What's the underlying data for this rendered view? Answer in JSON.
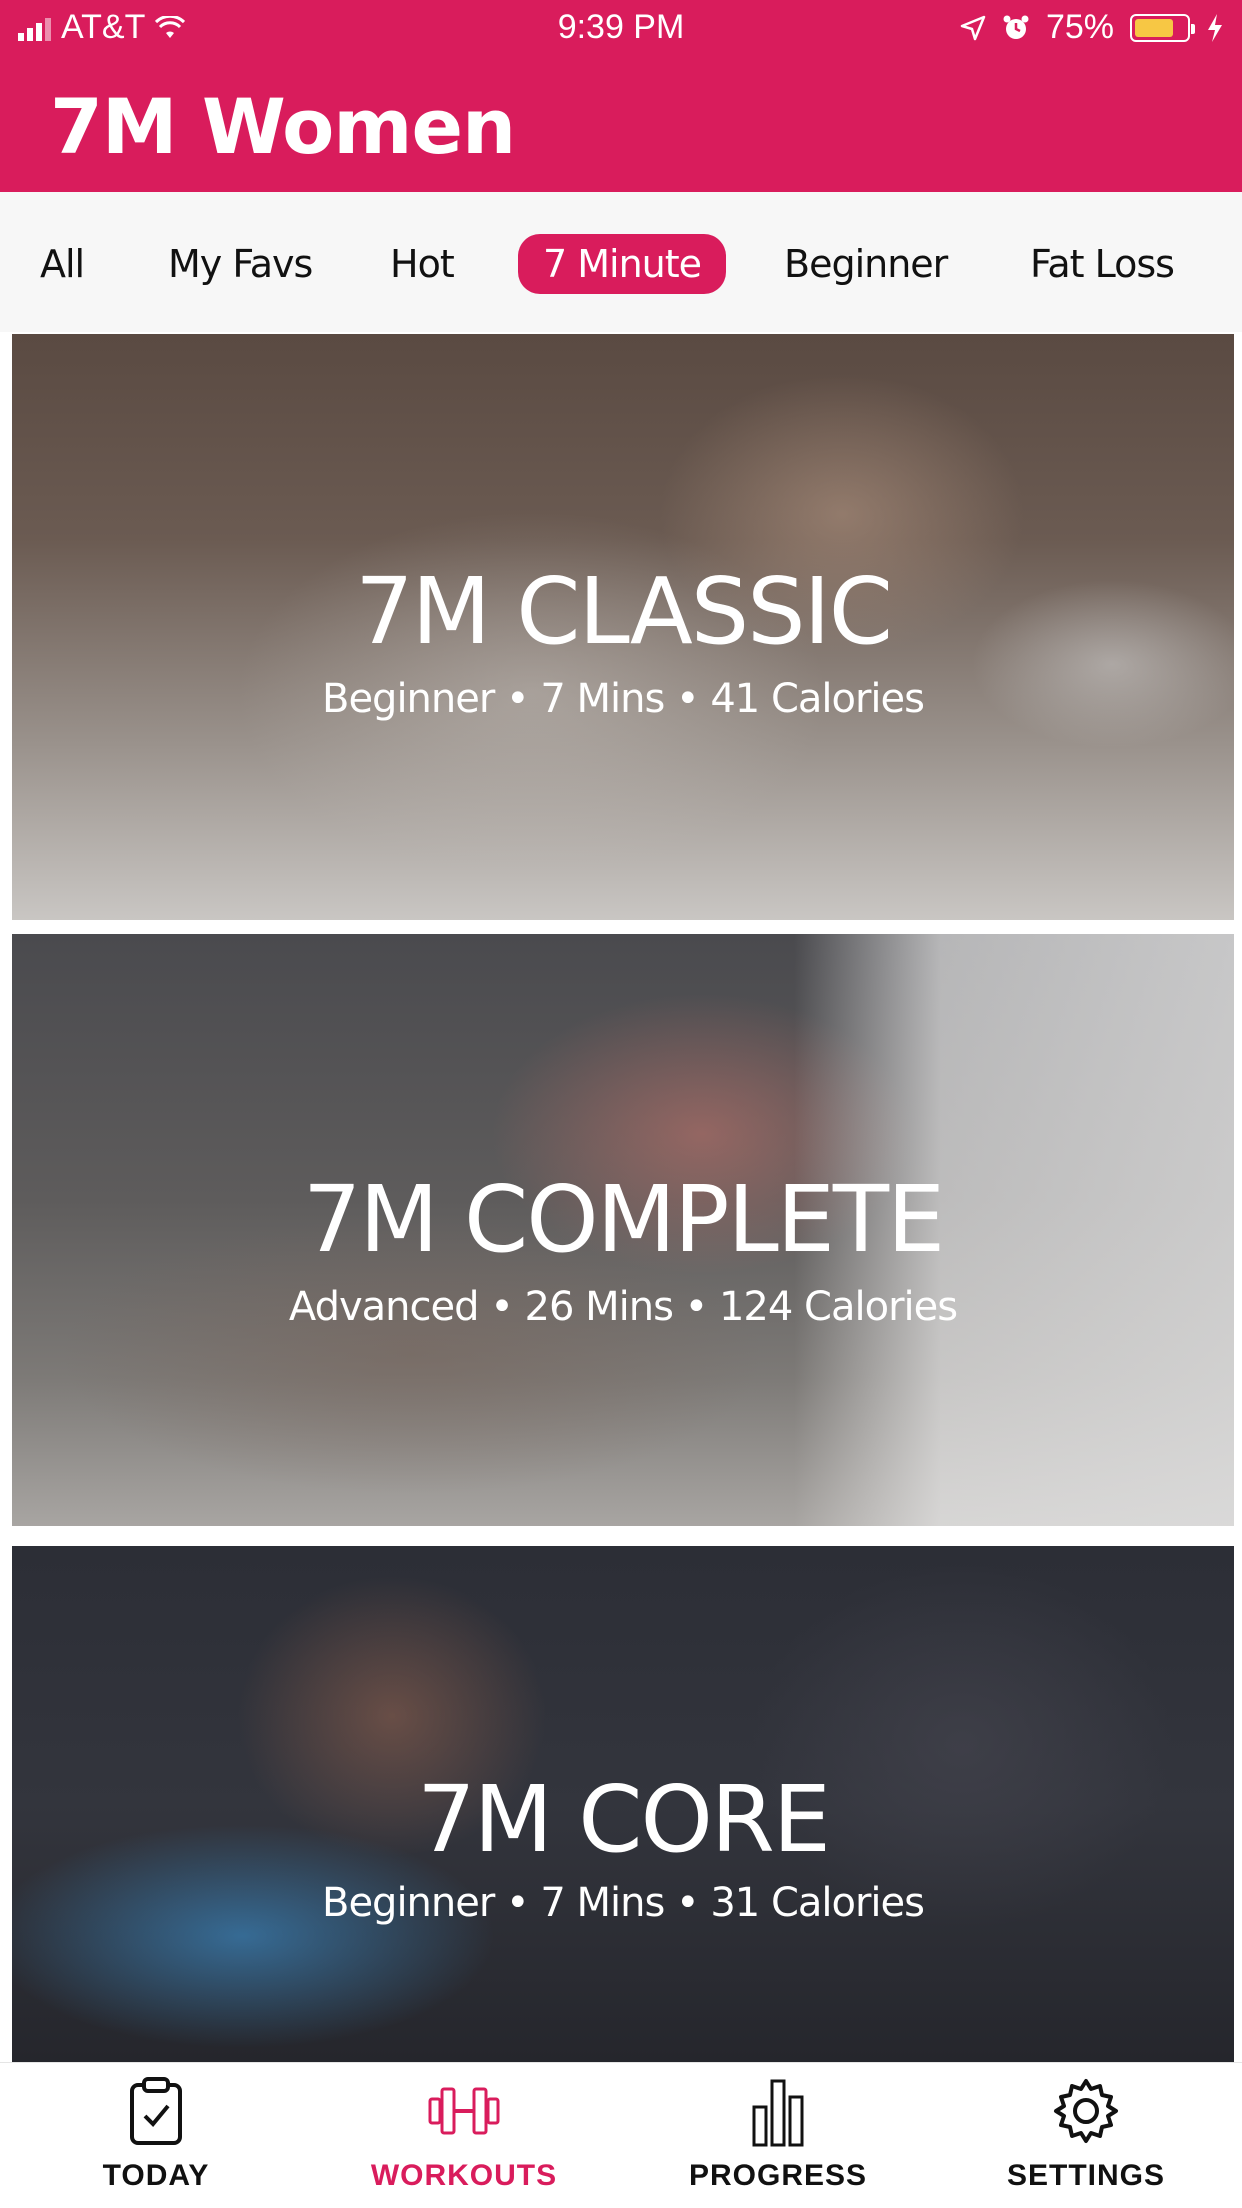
{
  "status_bar": {
    "carrier": "AT&T",
    "time": "9:39 PM",
    "battery_percent": "75%",
    "battery_level": 0.75,
    "icons": [
      "signal-icon",
      "wifi-icon",
      "location-icon",
      "alarm-icon",
      "battery-icon",
      "charging-icon"
    ]
  },
  "header": {
    "title": "7M Women",
    "background_color": "#d91c5c"
  },
  "filter_tabs": [
    {
      "label": "All",
      "active": false
    },
    {
      "label": "My Favs",
      "active": false
    },
    {
      "label": "Hot",
      "active": false
    },
    {
      "label": "7 Minute",
      "active": true
    },
    {
      "label": "Beginner",
      "active": false
    },
    {
      "label": "Fat Loss",
      "active": false
    }
  ],
  "workouts": [
    {
      "title": "7M CLASSIC",
      "meta": "Beginner • 7 Mins • 41 Calories"
    },
    {
      "title": "7M COMPLETE",
      "meta": "Advanced • 26 Mins • 124 Calories"
    },
    {
      "title": "7M CORE",
      "meta": "Beginner • 7 Mins • 31 Calories"
    }
  ],
  "bottom_nav": [
    {
      "label": "TODAY",
      "icon": "clipboard-check-icon",
      "active": false
    },
    {
      "label": "WORKOUTS",
      "icon": "dumbbell-icon",
      "active": true
    },
    {
      "label": "PROGRESS",
      "icon": "bar-chart-icon",
      "active": false
    },
    {
      "label": "SETTINGS",
      "icon": "gear-icon",
      "active": false
    }
  ],
  "colors": {
    "accent": "#d91c5c",
    "battery": "#f7c744"
  }
}
